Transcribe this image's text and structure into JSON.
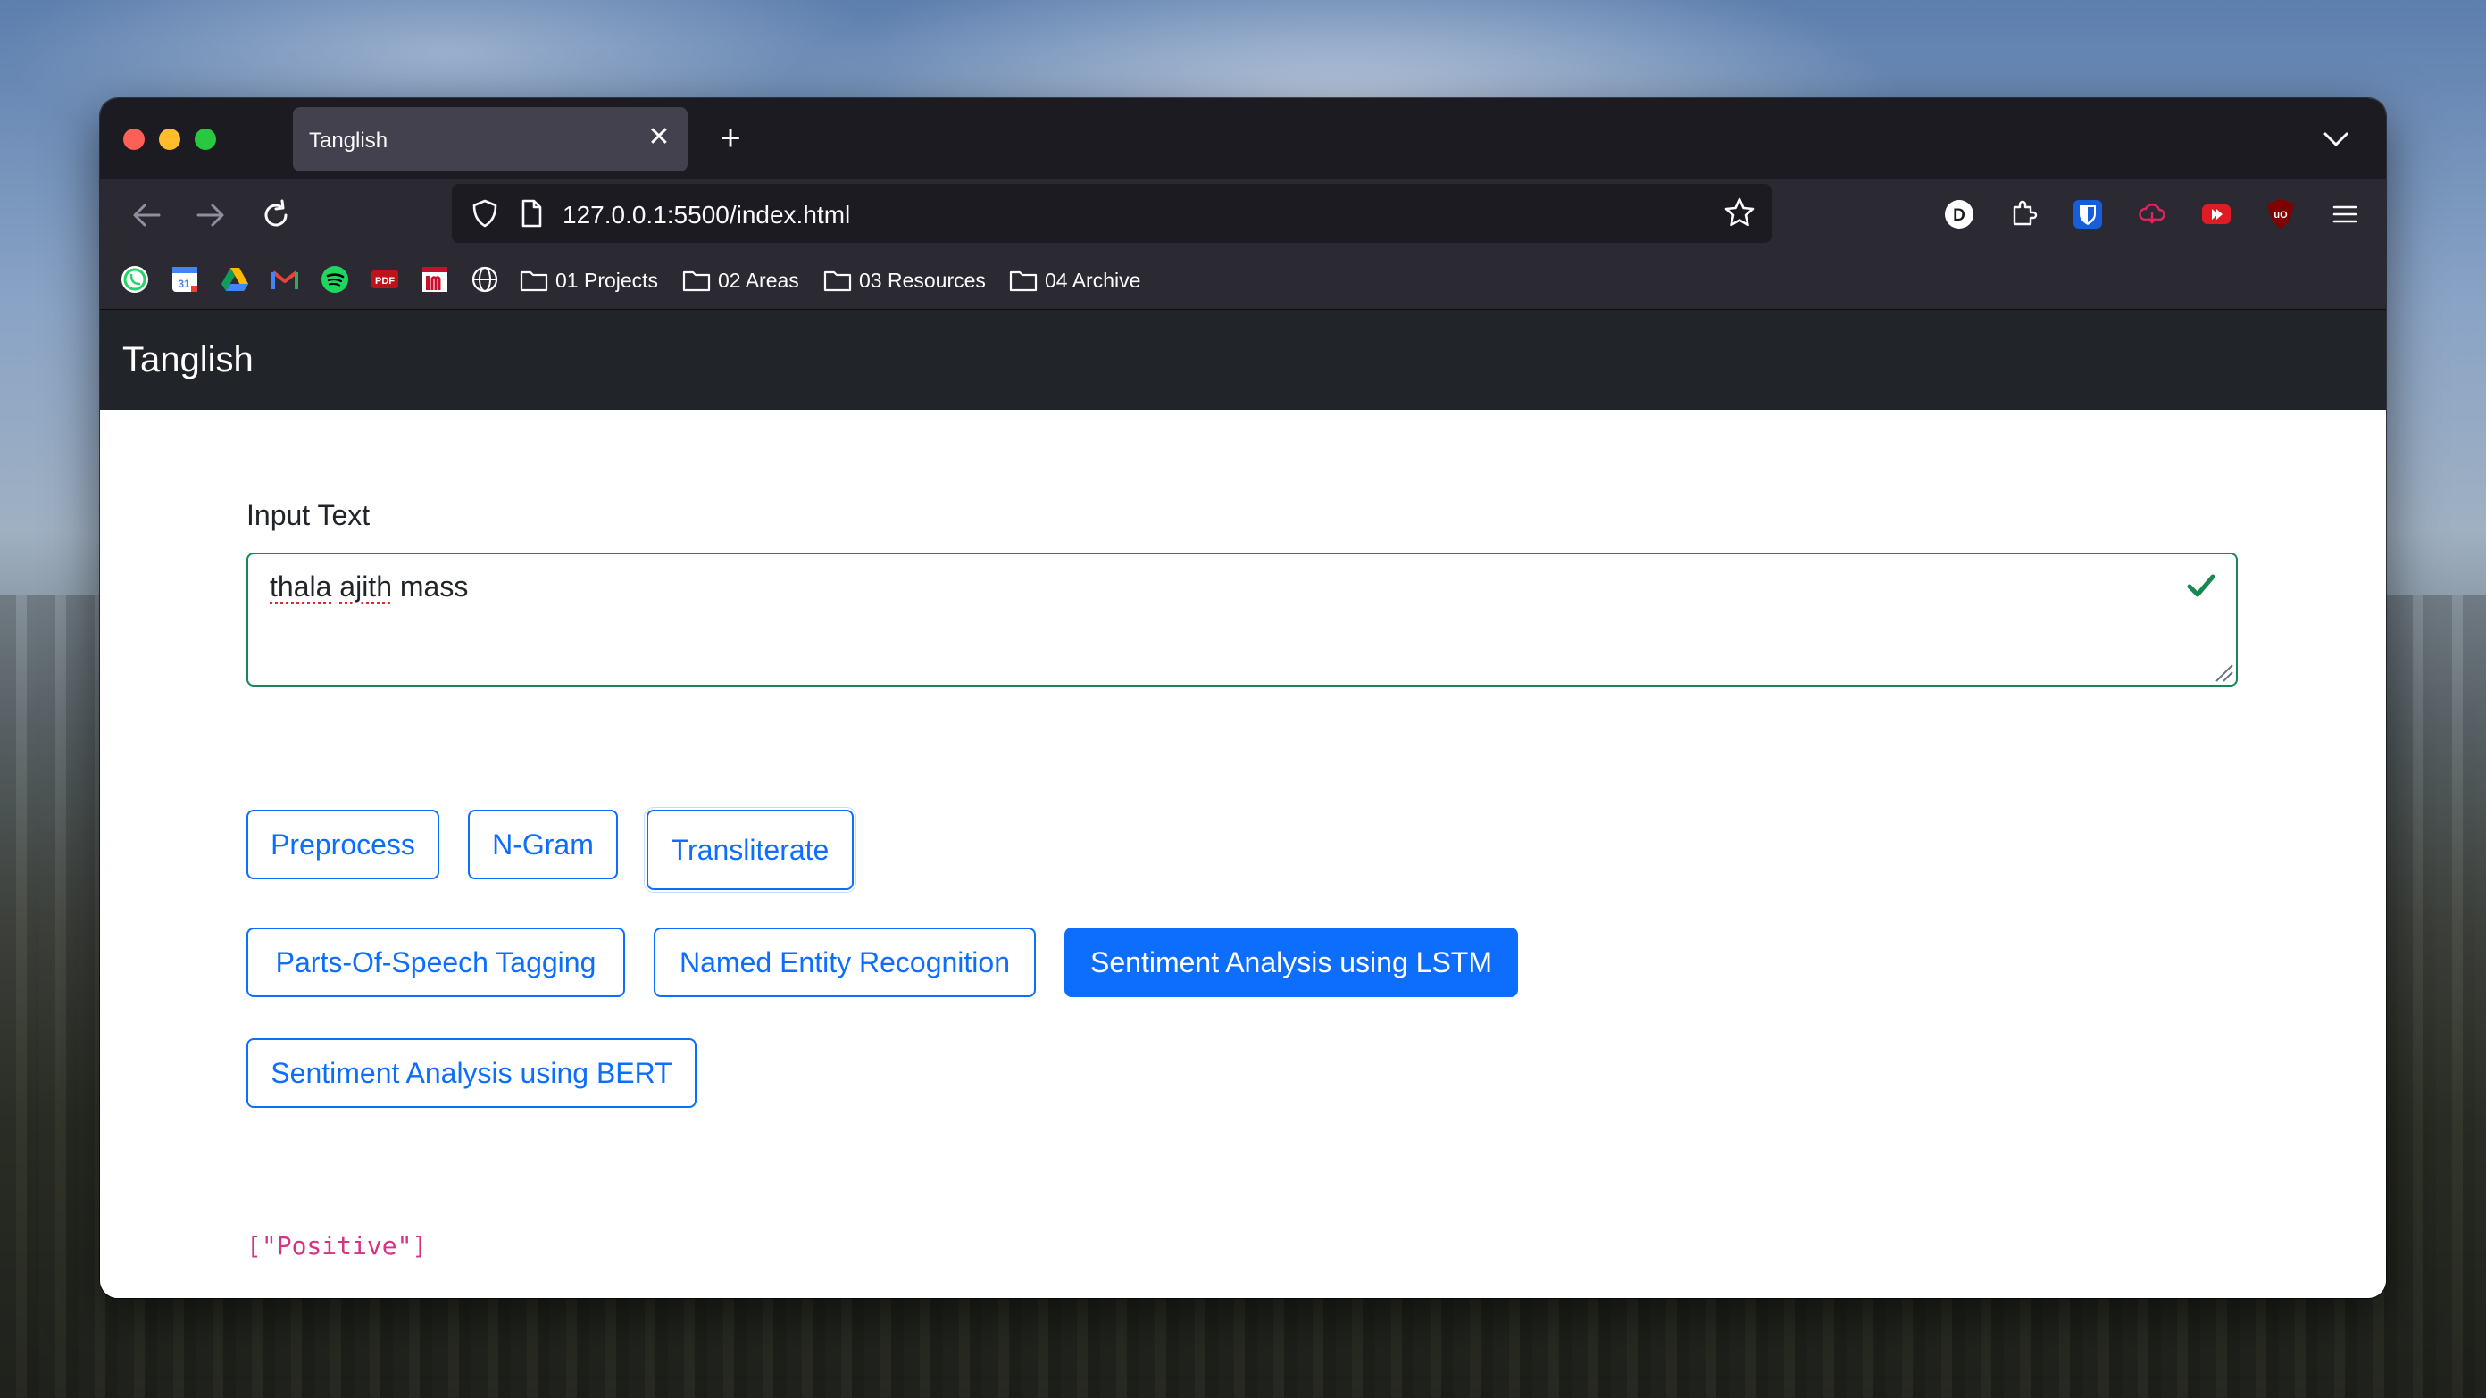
{
  "browser": {
    "tab_title": "Tanglish",
    "url": "127.0.0.1:5500/index.html",
    "profile_initial": "D",
    "bookmarks_folders": [
      "01 Projects",
      "02 Areas",
      "03 Resources",
      "04 Archive"
    ],
    "bookmark_icons": [
      "whatsapp-icon",
      "google-calendar-icon",
      "google-drive-icon",
      "gmail-icon",
      "spotify-icon",
      "pdf-icon",
      "imdb-icon",
      "globe-icon"
    ],
    "calendar_date": "31",
    "pdf_label": "PDF"
  },
  "app": {
    "brand": "Tanglish",
    "input_label": "Input Text",
    "input_words": [
      "thala",
      "ajith",
      "mass"
    ],
    "buttons": {
      "preprocess": "Preprocess",
      "ngram": "N-Gram",
      "transliterate": "Transliterate",
      "pos": "Parts-Of-Speech Tagging",
      "ner": "Named Entity Recognition",
      "lstm": "Sentiment Analysis using LSTM",
      "bert": "Sentiment Analysis using BERT"
    },
    "active_button": "lstm",
    "result": "[\"Positive\"]"
  },
  "colors": {
    "primary": "#0d6efd",
    "success": "#198754",
    "code": "#d63384",
    "navbar": "#212529"
  }
}
